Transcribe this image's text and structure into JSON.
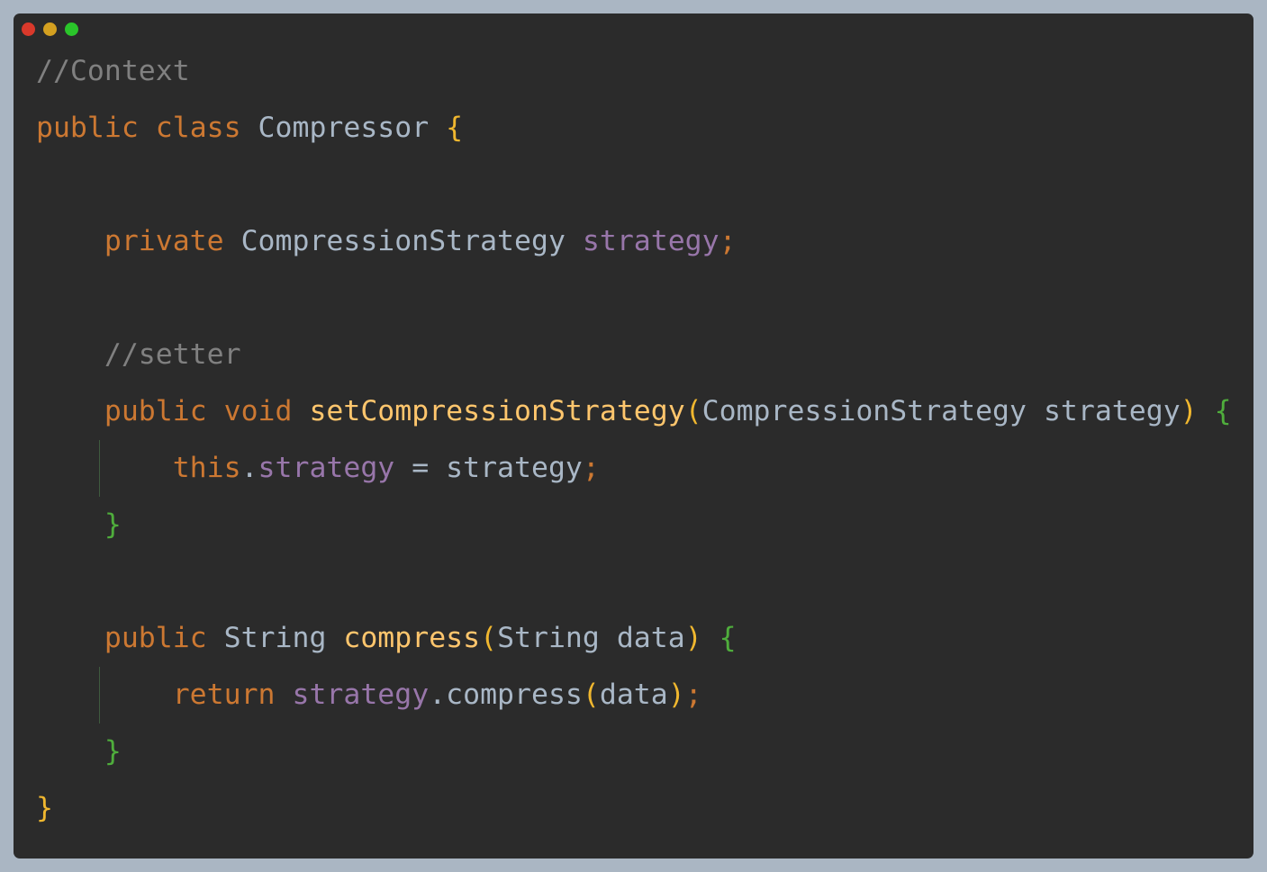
{
  "window": {
    "controls": [
      {
        "name": "close",
        "color": "#d9392b"
      },
      {
        "name": "minimize",
        "color": "#d4a020"
      },
      {
        "name": "maximize",
        "color": "#2ac52a"
      }
    ]
  },
  "code": {
    "lines": [
      {
        "indent": 0,
        "tokens": [
          {
            "t": "//Context",
            "c": "cm"
          }
        ]
      },
      {
        "indent": 0,
        "tokens": [
          {
            "t": "public",
            "c": "kw"
          },
          {
            "t": " "
          },
          {
            "t": "class",
            "c": "kw"
          },
          {
            "t": " Compressor ",
            "c": "pl"
          },
          {
            "t": "{",
            "c": "by"
          }
        ]
      },
      {
        "indent": 0,
        "tokens": []
      },
      {
        "indent": 1,
        "tokens": [
          {
            "t": "private",
            "c": "kw"
          },
          {
            "t": " CompressionStrategy ",
            "c": "pl"
          },
          {
            "t": "strategy",
            "c": "fd"
          },
          {
            "t": ";",
            "c": "sc"
          }
        ]
      },
      {
        "indent": 0,
        "tokens": []
      },
      {
        "indent": 1,
        "tokens": [
          {
            "t": "//setter",
            "c": "cm"
          }
        ]
      },
      {
        "indent": 1,
        "tokens": [
          {
            "t": "public",
            "c": "kw"
          },
          {
            "t": " "
          },
          {
            "t": "void",
            "c": "kw"
          },
          {
            "t": " "
          },
          {
            "t": "setCompressionStrategy",
            "c": "fn"
          },
          {
            "t": "(",
            "c": "by"
          },
          {
            "t": "CompressionStrategy strategy",
            "c": "pl"
          },
          {
            "t": ")",
            "c": "by"
          },
          {
            "t": " "
          },
          {
            "t": "{",
            "c": "bg"
          }
        ]
      },
      {
        "indent": 2,
        "guide": true,
        "tokens": [
          {
            "t": "this",
            "c": "kw"
          },
          {
            "t": ".",
            "c": "pl"
          },
          {
            "t": "strategy",
            "c": "fd"
          },
          {
            "t": " = strategy",
            "c": "pl"
          },
          {
            "t": ";",
            "c": "sc"
          }
        ]
      },
      {
        "indent": 1,
        "tokens": [
          {
            "t": "}",
            "c": "bg"
          }
        ]
      },
      {
        "indent": 0,
        "tokens": []
      },
      {
        "indent": 1,
        "tokens": [
          {
            "t": "public",
            "c": "kw"
          },
          {
            "t": " String ",
            "c": "pl"
          },
          {
            "t": "compress",
            "c": "fn"
          },
          {
            "t": "(",
            "c": "by"
          },
          {
            "t": "String data",
            "c": "pl"
          },
          {
            "t": ")",
            "c": "by"
          },
          {
            "t": " "
          },
          {
            "t": "{",
            "c": "bg"
          }
        ]
      },
      {
        "indent": 2,
        "guide": true,
        "tokens": [
          {
            "t": "return",
            "c": "kw"
          },
          {
            "t": " "
          },
          {
            "t": "strategy",
            "c": "fd"
          },
          {
            "t": ".compress",
            "c": "pl"
          },
          {
            "t": "(",
            "c": "by"
          },
          {
            "t": "data",
            "c": "pl"
          },
          {
            "t": ")",
            "c": "by"
          },
          {
            "t": ";",
            "c": "sc"
          }
        ]
      },
      {
        "indent": 1,
        "tokens": [
          {
            "t": "}",
            "c": "bg"
          }
        ]
      },
      {
        "indent": 0,
        "tokens": [
          {
            "t": "}",
            "c": "by"
          }
        ]
      }
    ]
  }
}
